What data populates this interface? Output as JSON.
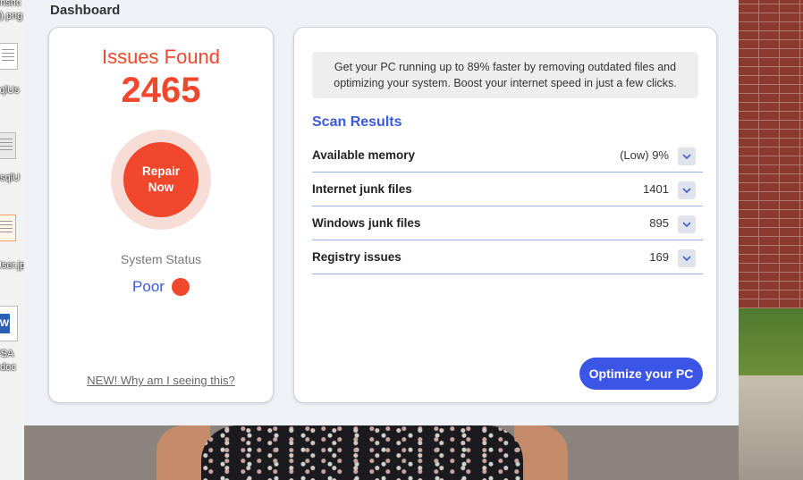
{
  "app": {
    "title": "Dashboard"
  },
  "desktop": {
    "icon_labels": [
      "enshc",
      "3).png",
      "sqlUs",
      "osqlU",
      "User.jp",
      "FSA",
      "r.doc"
    ]
  },
  "left_panel": {
    "issues_title": "Issues Found",
    "issues_count": "2465",
    "repair_button": "Repair Now",
    "status_label": "System Status",
    "status_value": "Poor",
    "why_link": "NEW! Why am I seeing this?"
  },
  "right_panel": {
    "promo_text": "Get your PC running up to 89% faster by removing outdated files and optimizing your system. Boost your internet speed in just a few clicks.",
    "scan_heading": "Scan Results",
    "results": [
      {
        "label": "Available memory",
        "value": "(Low) 9%"
      },
      {
        "label": "Internet junk files",
        "value": "1401"
      },
      {
        "label": "Windows junk files",
        "value": "895"
      },
      {
        "label": "Registry issues",
        "value": "169"
      }
    ],
    "optimize_button": "Optimize your PC"
  },
  "colors": {
    "accent_red": "#f0472d",
    "accent_blue": "#3b55e6",
    "heading_blue": "#3b5bd6"
  }
}
